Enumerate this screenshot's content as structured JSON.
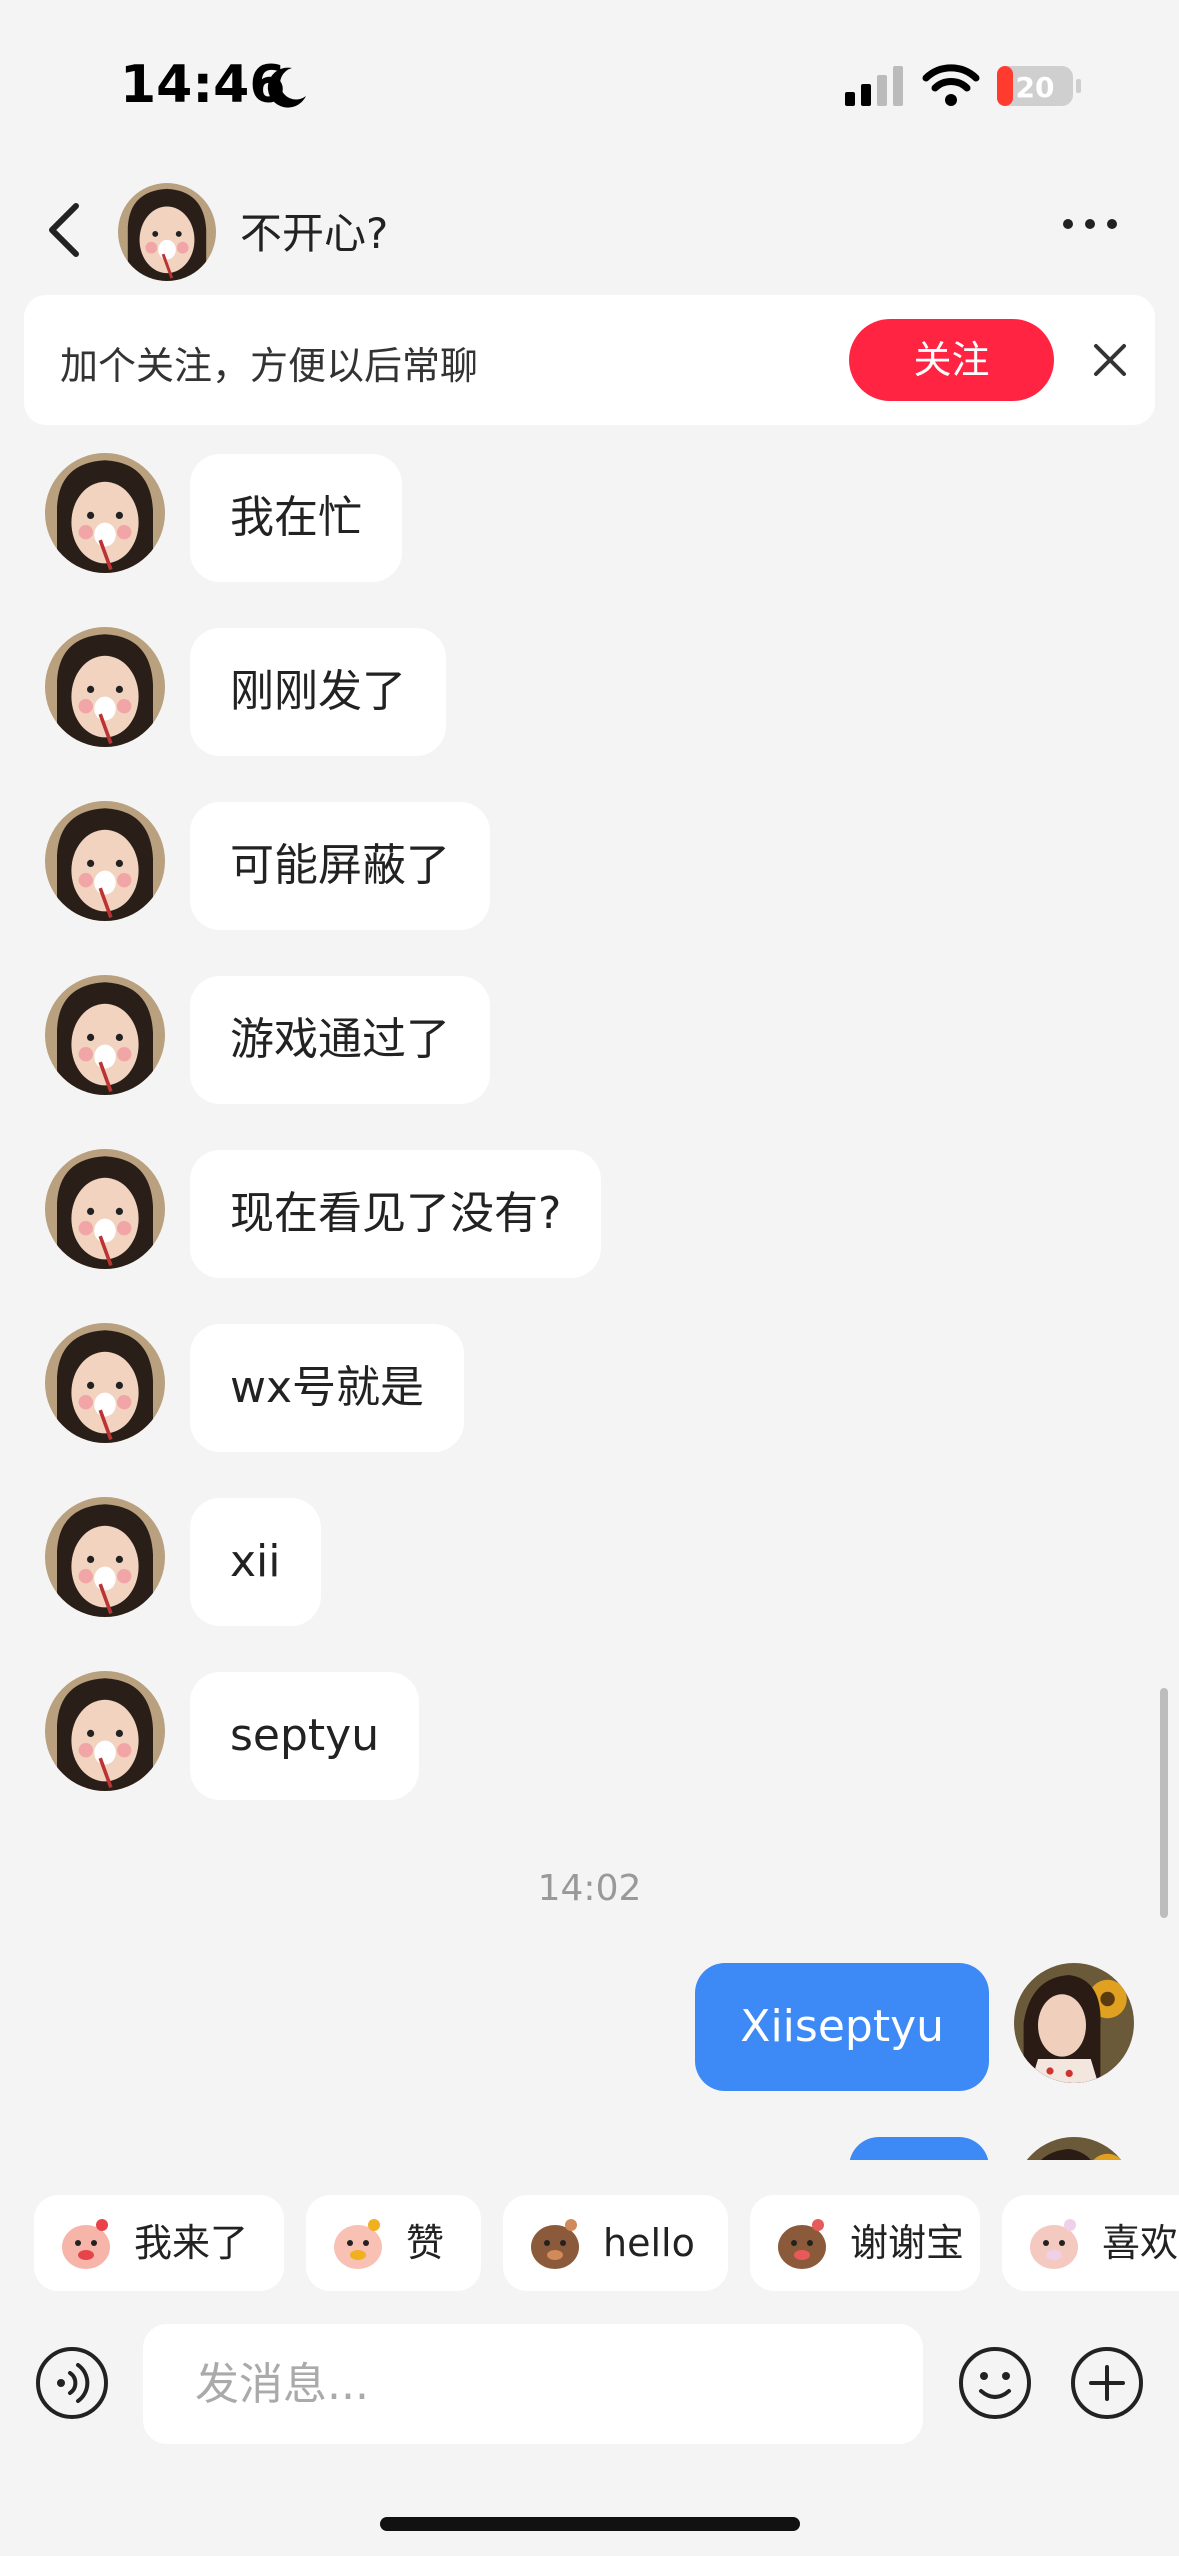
{
  "status_bar": {
    "time": "14:46",
    "battery": "20"
  },
  "header": {
    "title": "不开心?"
  },
  "follow_banner": {
    "text": "加个关注，方便以后常聊",
    "button": "关注"
  },
  "messages": [
    {
      "text": "我在忙"
    },
    {
      "text": "刚刚发了"
    },
    {
      "text": "可能屏蔽了"
    },
    {
      "text": "游戏通过了"
    },
    {
      "text": "现在看见了没有?"
    },
    {
      "text": "wx号就是"
    },
    {
      "text": "xii"
    },
    {
      "text": "septyu"
    }
  ],
  "timestamp": "14:02",
  "sent_messages": [
    {
      "text": "Xiiseptyu"
    },
    {
      "text": ""
    }
  ],
  "quick_replies": [
    {
      "label": "我来了",
      "icon": "sticker-pig-waving-icon"
    },
    {
      "label": "赞",
      "icon": "sticker-pig-clap-icon"
    },
    {
      "label": "hello",
      "icon": "sticker-monkey-icon"
    },
    {
      "label": "谢谢宝",
      "icon": "sticker-monkey-flower-icon"
    },
    {
      "label": "喜欢",
      "icon": "sticker-sheep-icon"
    }
  ],
  "input": {
    "placeholder": "发消息..."
  },
  "colors": {
    "accent_red": "#ff2442",
    "bubble_blue": "#3d8af7",
    "background": "#f4f4f4"
  }
}
